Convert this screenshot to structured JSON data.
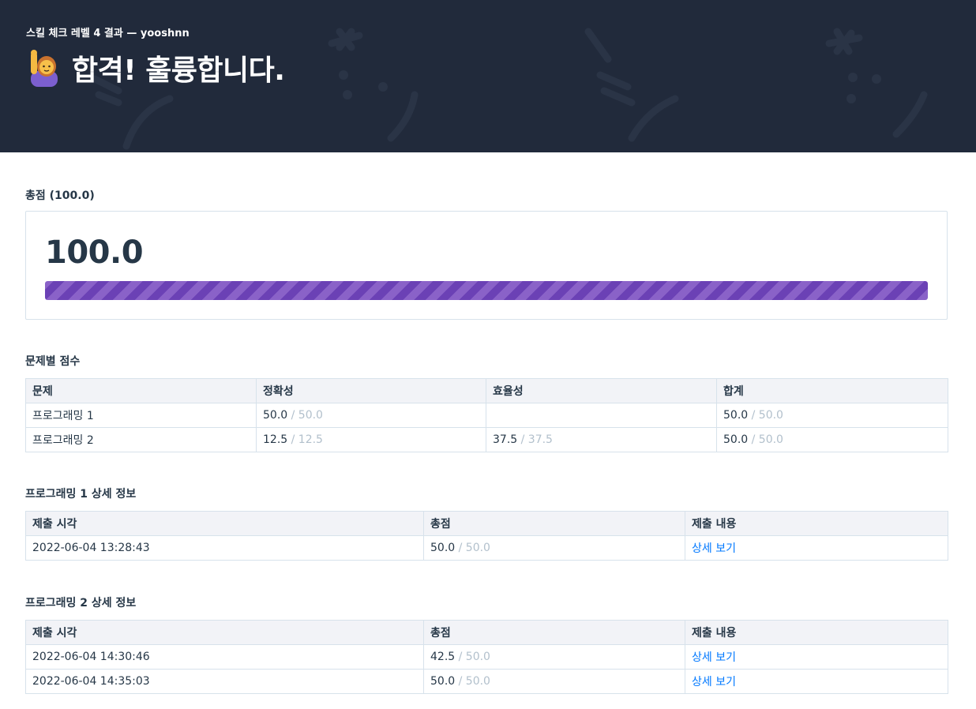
{
  "header": {
    "subtitle": "스킬 체크 레벨 4 결과 — yooshnn",
    "title": "합격! 훌륭합니다.",
    "emoji_icon": "person-raising-hand-icon"
  },
  "total": {
    "section_title": "총점 (100.0)",
    "score": "100.0",
    "progress_fraction": 1.0,
    "bar_color": "#6b41b5"
  },
  "problem_scores": {
    "section_title": "문제별 점수",
    "headers": [
      "문제",
      "정확성",
      "효율성",
      "합계"
    ],
    "rows": [
      {
        "name": "프로그래밍 1",
        "accuracy": "50.0",
        "accuracy_max": "/ 50.0",
        "efficiency": "",
        "efficiency_max": "",
        "total": "50.0",
        "total_max": "/ 50.0"
      },
      {
        "name": "프로그래밍 2",
        "accuracy": "12.5",
        "accuracy_max": "/ 12.5",
        "efficiency": "37.5",
        "efficiency_max": "/ 37.5",
        "total": "50.0",
        "total_max": "/ 50.0"
      }
    ]
  },
  "details": [
    {
      "section_title": "프로그래밍 1 상세 정보",
      "headers": [
        "제출 시각",
        "총점",
        "제출 내용"
      ],
      "rows": [
        {
          "time": "2022-06-04 13:28:43",
          "score": "50.0",
          "score_max": "/ 50.0",
          "link": "상세 보기"
        }
      ]
    },
    {
      "section_title": "프로그래밍 2 상세 정보",
      "headers": [
        "제출 시각",
        "총점",
        "제출 내용"
      ],
      "rows": [
        {
          "time": "2022-06-04 14:30:46",
          "score": "42.5",
          "score_max": "/ 50.0",
          "link": "상세 보기"
        },
        {
          "time": "2022-06-04 14:35:03",
          "score": "50.0",
          "score_max": "/ 50.0",
          "link": "상세 보기"
        }
      ]
    }
  ]
}
